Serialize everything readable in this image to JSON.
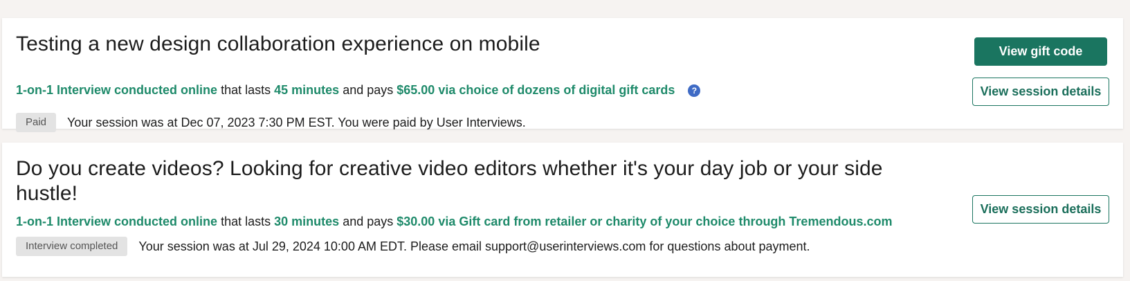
{
  "studies": [
    {
      "title": "Testing a new design collaboration experience on mobile",
      "format": "1-on-1 Interview conducted online",
      "lasts_text": "that lasts",
      "duration": "45 minutes",
      "pays_text": "and pays",
      "payment": "$65.00 via choice of dozens of digital gift cards",
      "help_icon": "?",
      "badge": "Paid",
      "status_text": "Your session was at Dec 07, 2023 7:30 PM EST. You were paid by User Interviews.",
      "primary_button": "View gift code",
      "secondary_button": "View session details"
    },
    {
      "title": "Do you create videos? Looking for creative video editors whether it's your day job or your side hustle!",
      "format": "1-on-1 Interview conducted online",
      "lasts_text": "that lasts",
      "duration": "30 minutes",
      "pays_text": "and pays",
      "payment": "$30.00 via Gift card from retailer or charity of your choice through Tremendous.com",
      "badge": "Interview completed",
      "status_text": "Your session was at Jul 29, 2024 10:00 AM EDT. Please email support@userinterviews.com for questions about payment.",
      "secondary_button": "View session details"
    }
  ],
  "colors": {
    "accent_green": "#1e8a6a",
    "button_green": "#1a7560",
    "help_blue": "#3f6bc5",
    "page_bg": "#f6f3f1",
    "badge_bg": "#e3e3e3"
  },
  "icons": {
    "help": "question-circle-icon"
  }
}
